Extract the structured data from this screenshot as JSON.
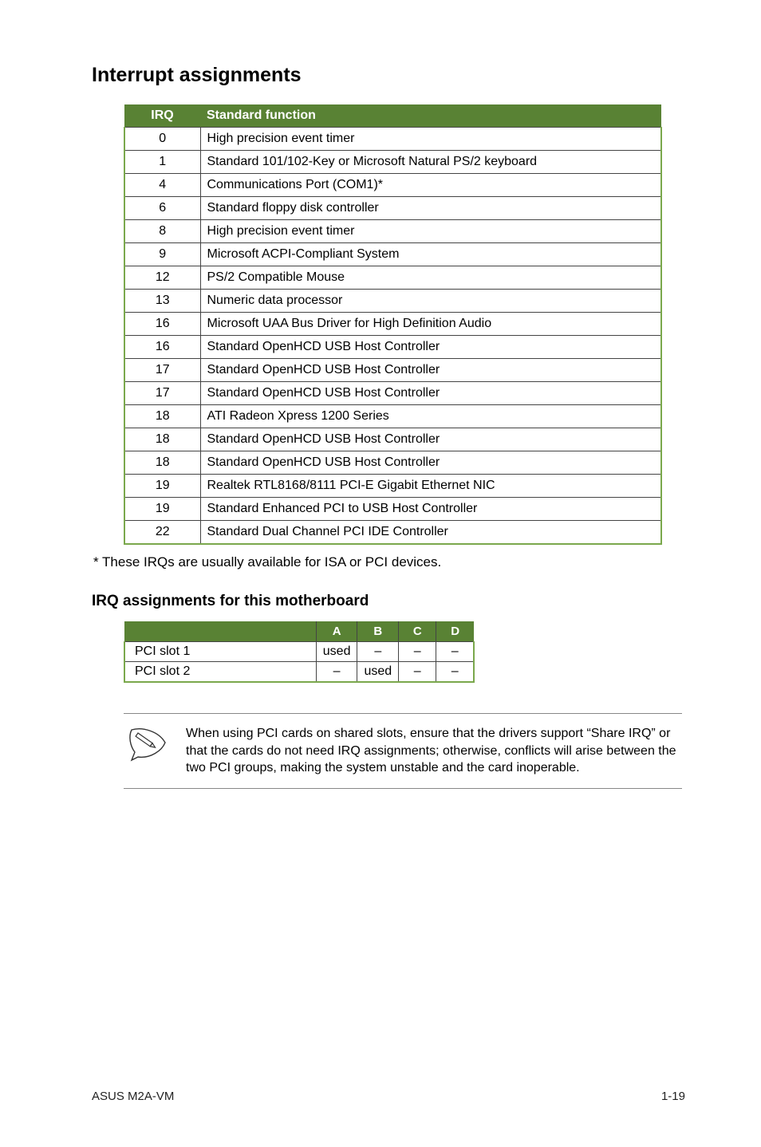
{
  "heading": "Interrupt assignments",
  "irq_table": {
    "headers": {
      "irq": "IRQ",
      "func": "Standard function"
    },
    "rows": [
      {
        "irq": "0",
        "func": "High precision event timer"
      },
      {
        "irq": "1",
        "func": "Standard 101/102-Key or Microsoft Natural PS/2 keyboard"
      },
      {
        "irq": "4",
        "func": "Communications Port (COM1)*"
      },
      {
        "irq": "6",
        "func": "Standard floppy disk controller"
      },
      {
        "irq": "8",
        "func": "High precision event timer"
      },
      {
        "irq": "9",
        "func": "Microsoft ACPI-Compliant System"
      },
      {
        "irq": "12",
        "func": "PS/2 Compatible Mouse"
      },
      {
        "irq": "13",
        "func": "Numeric data processor"
      },
      {
        "irq": "16",
        "func": "Microsoft UAA Bus Driver for High Definition Audio"
      },
      {
        "irq": "16",
        "func": "Standard OpenHCD USB Host Controller"
      },
      {
        "irq": "17",
        "func": "Standard OpenHCD USB Host Controller"
      },
      {
        "irq": "17",
        "func": "Standard OpenHCD USB Host Controller"
      },
      {
        "irq": "18",
        "func": "ATI Radeon Xpress 1200 Series"
      },
      {
        "irq": "18",
        "func": "Standard OpenHCD USB Host Controller"
      },
      {
        "irq": "18",
        "func": "Standard OpenHCD USB Host Controller"
      },
      {
        "irq": "19",
        "func": "Realtek RTL8168/8111 PCI-E Gigabit Ethernet NIC"
      },
      {
        "irq": "19",
        "func": "Standard Enhanced PCI to USB Host Controller"
      },
      {
        "irq": "22",
        "func": "Standard Dual Channel PCI IDE Controller"
      }
    ]
  },
  "footnote": "* These IRQs are usually available for ISA or PCI devices.",
  "subheading": "IRQ assignments for this motherboard",
  "slot_table": {
    "headers": [
      "A",
      "B",
      "C",
      "D"
    ],
    "rows": [
      {
        "name": "PCI slot 1",
        "cells": [
          "used",
          "–",
          "–",
          "–"
        ]
      },
      {
        "name": "PCI slot 2",
        "cells": [
          "–",
          "used",
          "–",
          "–"
        ]
      }
    ]
  },
  "note_text": "When using PCI cards on shared slots, ensure that the drivers support “Share IRQ” or that the cards do not need IRQ assignments; otherwise, conflicts will arise between the two PCI groups, making the system unstable and the card inoperable.",
  "footer": {
    "left": "ASUS M2A-VM",
    "right": "1-19"
  }
}
